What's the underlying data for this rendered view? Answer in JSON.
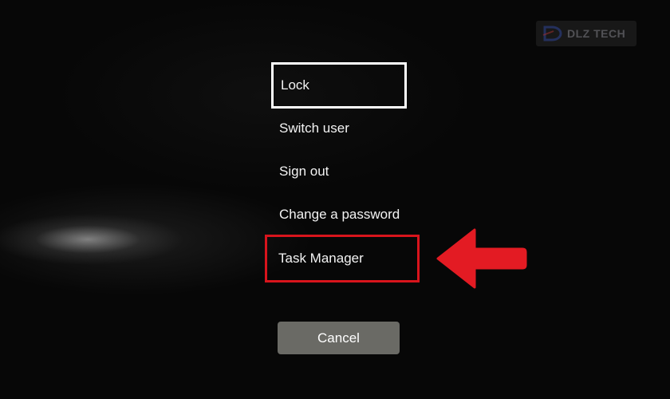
{
  "watermark": {
    "brand_text": "DLZ TECH"
  },
  "menu": {
    "items": [
      {
        "label": "Lock",
        "state": "focused"
      },
      {
        "label": "Switch user"
      },
      {
        "label": "Sign out"
      },
      {
        "label": "Change a password"
      },
      {
        "label": "Task Manager",
        "state": "highlighted"
      }
    ]
  },
  "cancel": {
    "label": "Cancel"
  },
  "annotations": {
    "highlight_color": "#d8141c",
    "arrow_color": "#e31b23",
    "arrow_icon": "left-arrow-icon"
  },
  "colors": {
    "background": "#070707",
    "text": "#f3f3f3",
    "button": "#6a6a65"
  }
}
